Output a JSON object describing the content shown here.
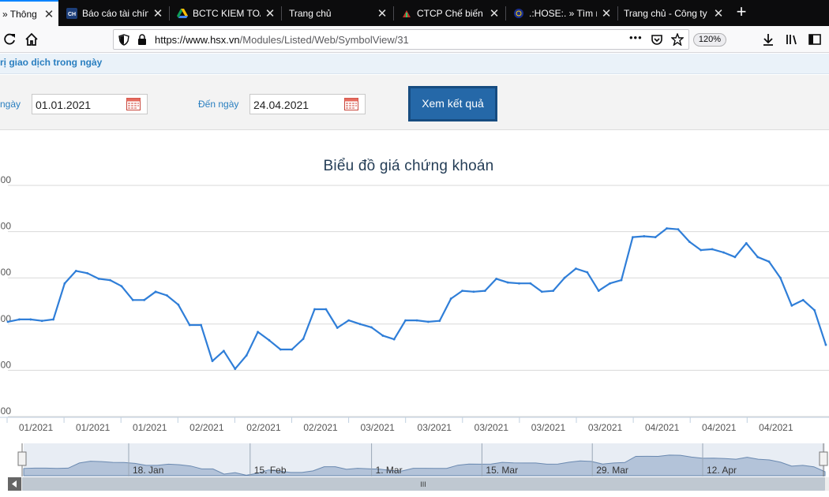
{
  "browser": {
    "tabs": [
      {
        "label": "» Thông ti",
        "icon": "hsx-favicon"
      },
      {
        "label": "Báo cáo tài chính",
        "icon": "cafef-favicon"
      },
      {
        "label": "BCTC KIEM TOAN",
        "icon": "google-drive-icon"
      },
      {
        "label": "Trang chủ",
        "icon": "blank-page-icon"
      },
      {
        "label": "CTCP Chế biến Th",
        "icon": "leaf-favicon"
      },
      {
        "label": ".:HOSE:. » Tìm nh",
        "icon": "hose-globe-icon"
      },
      {
        "label": "Trang chủ - Công ty C",
        "icon": "blank-page-icon"
      }
    ],
    "new_tab": "+",
    "url_host": "https://www.hsx.vn",
    "url_path": "/Modules/Listed/Web/SymbolView/31",
    "zoom": "120%",
    "more": "•••"
  },
  "page": {
    "section_title": "rị giao dịch trong ngày",
    "from_label": "ngày",
    "from_value": "01.01.2021",
    "to_label": "Đến ngày",
    "to_value": "24.04.2021",
    "submit": "Xem kết quả"
  },
  "chart_data": {
    "type": "line",
    "title": "Biểu đồ giá chứng khoán",
    "y_tick_labels": [
      "00",
      "00",
      "00",
      "00",
      "00",
      "00"
    ],
    "y_tick_values": [
      0,
      1,
      2,
      3,
      4,
      5
    ],
    "ylim": [
      0,
      5
    ],
    "xlabel": "",
    "ylabel": "",
    "x_tick_labels": [
      "01/2021",
      "01/2021",
      "01/2021",
      "02/2021",
      "02/2021",
      "02/2021",
      "03/2021",
      "03/2021",
      "03/2021",
      "03/2021",
      "03/2021",
      "04/2021",
      "04/2021",
      "04/2021"
    ],
    "grid": true,
    "color": "#2f7ed8",
    "series": [
      {
        "values": [
          2.05,
          2.1,
          2.1,
          2.07,
          2.1,
          2.88,
          3.15,
          3.1,
          2.98,
          2.95,
          2.82,
          2.52,
          2.52,
          2.7,
          2.62,
          2.42,
          1.98,
          1.98,
          1.2,
          1.42,
          1.03,
          1.32,
          1.83,
          1.65,
          1.45,
          1.45,
          1.68,
          2.32,
          2.32,
          1.92,
          2.08,
          2.0,
          1.93,
          1.75,
          1.67,
          2.08,
          2.08,
          2.05,
          2.07,
          2.55,
          2.72,
          2.7,
          2.72,
          2.98,
          2.9,
          2.88,
          2.88,
          2.7,
          2.72,
          3.0,
          3.2,
          3.12,
          2.72,
          2.88,
          2.95,
          3.88,
          3.9,
          3.88,
          4.07,
          4.05,
          3.78,
          3.6,
          3.62,
          3.55,
          3.45,
          3.75,
          3.45,
          3.35,
          3.0,
          2.4,
          2.52,
          2.3,
          1.55
        ]
      }
    ],
    "navigator": {
      "date_labels": [
        "18. Jan",
        "15. Feb",
        "1. Mar",
        "15. Mar",
        "29. Mar",
        "12. Apr"
      ],
      "scrollbar_grip": "III"
    }
  }
}
